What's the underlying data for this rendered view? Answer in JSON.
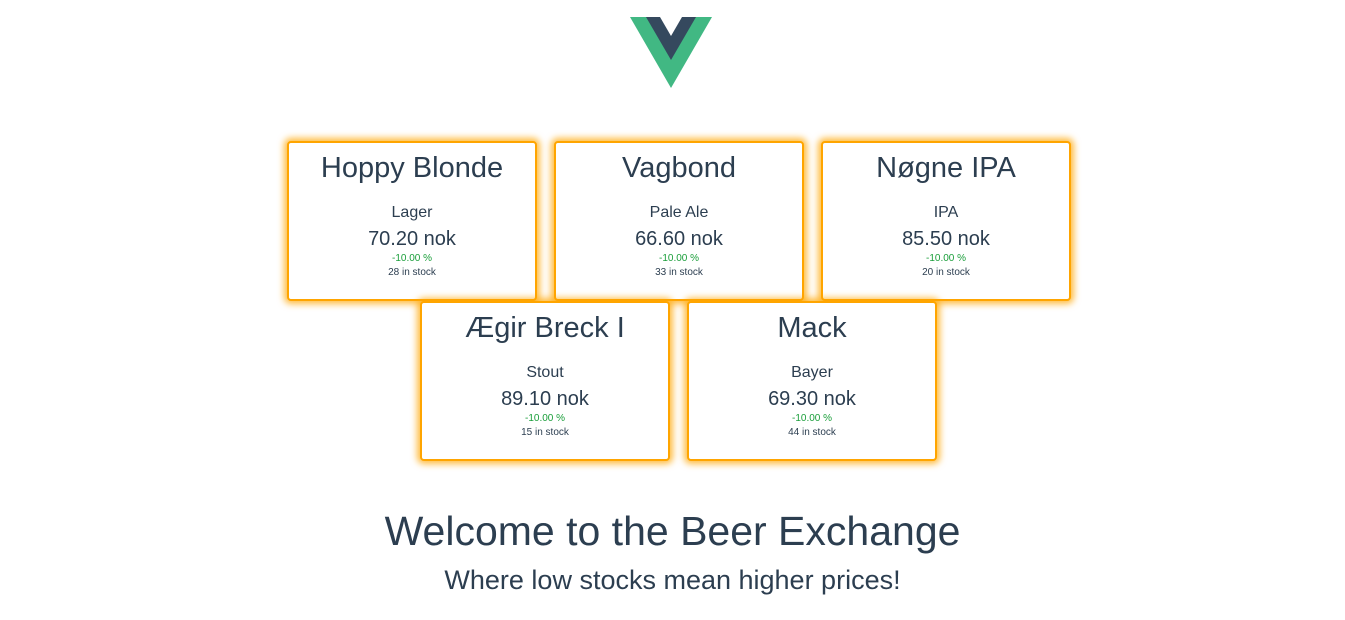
{
  "header": {
    "logo_icon": "vue-logo-icon",
    "logo_colors": {
      "outer": "#41b883",
      "inner": "#35495e"
    }
  },
  "cards": [
    {
      "name": "Hoppy Blonde",
      "type": "Lager",
      "price": "70.20 nok",
      "change": "-10.00 %",
      "stock": "28 in stock"
    },
    {
      "name": "Vagbond",
      "type": "Pale Ale",
      "price": "66.60 nok",
      "change": "-10.00 %",
      "stock": "33 in stock"
    },
    {
      "name": "Nøgne IPA",
      "type": "IPA",
      "price": "85.50 nok",
      "change": "-10.00 %",
      "stock": "20 in stock"
    },
    {
      "name": "Ægir Breck I",
      "type": "Stout",
      "price": "89.10 nok",
      "change": "-10.00 %",
      "stock": "15 in stock"
    },
    {
      "name": "Mack",
      "type": "Bayer",
      "price": "69.30 nok",
      "change": "-10.00 %",
      "stock": "44 in stock"
    }
  ],
  "welcome": {
    "title": "Welcome to the Beer Exchange",
    "subtitle": "Where low stocks mean higher prices!"
  },
  "colors": {
    "text": "#2c3e50",
    "card_border": "#ffa500",
    "change_text": "#1a9e3a"
  }
}
